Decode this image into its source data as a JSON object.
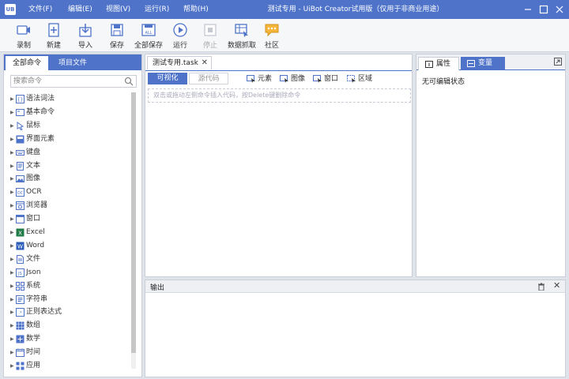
{
  "window": {
    "logo": "UB",
    "title": "测试专用 - UiBot Creator试用版（仅用于非商业用途）",
    "menu": [
      "文件(F)",
      "编辑(E)",
      "视图(V)",
      "运行(R)",
      "帮助(H)"
    ]
  },
  "toolbar": {
    "buttons": [
      {
        "label": "录制",
        "icon": "record-icon",
        "enabled": true
      },
      {
        "label": "新建",
        "icon": "new-icon",
        "enabled": true
      },
      {
        "label": "导入",
        "icon": "import-icon",
        "enabled": true
      },
      {
        "label": "保存",
        "icon": "save-icon",
        "enabled": true
      },
      {
        "label": "全部保存",
        "icon": "save-all-icon",
        "enabled": true
      },
      {
        "label": "运行",
        "icon": "run-icon",
        "enabled": true
      },
      {
        "label": "停止",
        "icon": "stop-icon",
        "enabled": false
      },
      {
        "label": "数据抓取",
        "icon": "data-scrape-icon",
        "enabled": true
      },
      {
        "label": "社区",
        "icon": "community-icon",
        "enabled": true
      }
    ]
  },
  "left_panel": {
    "tabs": [
      "全部命令",
      "项目文件"
    ],
    "search_placeholder": "搜索命令",
    "commands": [
      {
        "label": "语法词法",
        "icon": "syntax-icon"
      },
      {
        "label": "基本命令",
        "icon": "basic-icon"
      },
      {
        "label": "鼠标",
        "icon": "mouse-icon"
      },
      {
        "label": "界面元素",
        "icon": "ui-element-icon"
      },
      {
        "label": "键盘",
        "icon": "keyboard-icon"
      },
      {
        "label": "文本",
        "icon": "text-icon"
      },
      {
        "label": "图像",
        "icon": "image-icon"
      },
      {
        "label": "OCR",
        "icon": "ocr-icon"
      },
      {
        "label": "浏览器",
        "icon": "browser-icon"
      },
      {
        "label": "窗口",
        "icon": "window-icon"
      },
      {
        "label": "Excel",
        "icon": "excel-icon"
      },
      {
        "label": "Word",
        "icon": "word-icon"
      },
      {
        "label": "文件",
        "icon": "file-icon"
      },
      {
        "label": "Json",
        "icon": "json-icon"
      },
      {
        "label": "系统",
        "icon": "system-icon"
      },
      {
        "label": "字符串",
        "icon": "string-icon"
      },
      {
        "label": "正则表达式",
        "icon": "regex-icon"
      },
      {
        "label": "数组",
        "icon": "array-icon"
      },
      {
        "label": "数学",
        "icon": "math-icon"
      },
      {
        "label": "时间",
        "icon": "time-icon"
      },
      {
        "label": "应用",
        "icon": "app-icon"
      }
    ]
  },
  "editor": {
    "tab_label": "测试专用.task",
    "mode_visual": "可视化",
    "mode_source": "源代码",
    "capture_buttons": [
      "元素",
      "图像",
      "窗口",
      "区域"
    ],
    "drop_hint": "双击或拖动左侧命令插入代码，按Delete键删除命令"
  },
  "properties": {
    "tabs": [
      "属性",
      "变量"
    ],
    "empty_text": "无可编辑状态"
  },
  "output": {
    "title": "输出"
  },
  "colors": {
    "accent": "#4e73c9",
    "background": "#dfe3ea"
  }
}
